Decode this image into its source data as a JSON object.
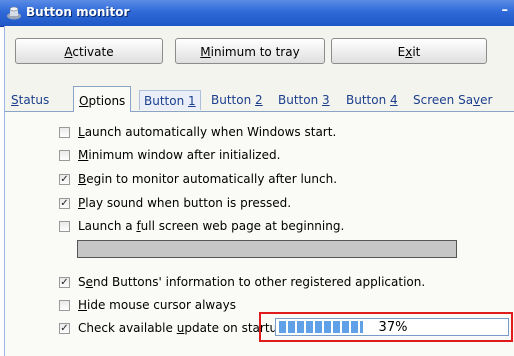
{
  "window": {
    "title": "Button monitor"
  },
  "toolbar": {
    "activate": {
      "pre": "",
      "key": "A",
      "post": "ctivate"
    },
    "minimum_to_tray": {
      "pre": "",
      "key": "M",
      "post": "inimum to tray"
    },
    "exit": {
      "pre": "E",
      "key": "x",
      "post": "it"
    }
  },
  "tabs": [
    {
      "pre": "",
      "key": "S",
      "post": "tatus"
    },
    {
      "pre": "",
      "key": "O",
      "post": "ptions"
    },
    {
      "pre": "Button ",
      "key": "1",
      "post": ""
    },
    {
      "pre": "Button ",
      "key": "2",
      "post": ""
    },
    {
      "pre": "Button ",
      "key": "3",
      "post": ""
    },
    {
      "pre": "Button ",
      "key": "4",
      "post": ""
    },
    {
      "pre": "Screen Sa",
      "key": "v",
      "post": "er"
    }
  ],
  "active_tab": "Options",
  "options": [
    {
      "pre": "",
      "key": "L",
      "post": "aunch automatically when Windows start.",
      "checked": false
    },
    {
      "pre": "",
      "key": "M",
      "post": "inimum window after initialized.",
      "checked": false
    },
    {
      "pre": "",
      "key": "B",
      "post": "egin to monitor automatically after lunch.",
      "checked": true
    },
    {
      "pre": "",
      "key": "P",
      "post": "lay sound when button is pressed.",
      "checked": true
    },
    {
      "pre": "Launch a ",
      "key": "f",
      "post": "ull screen web page at beginning.",
      "checked": false
    },
    {
      "pre": "S",
      "key": "e",
      "post": "nd Buttons' information to other registered application.",
      "checked": true
    },
    {
      "pre": "",
      "key": "H",
      "post": "ide mouse cursor always",
      "checked": false
    },
    {
      "pre": "Check available ",
      "key": "u",
      "post": "pdate on startup",
      "checked": true
    }
  ],
  "web_page_url": {
    "value": ""
  },
  "update_progress": {
    "percent": 37,
    "label": "37%"
  },
  "colors": {
    "titlebar": "#2f6ad8",
    "highlight": "#e11b1b",
    "progress": "#5fa0e6"
  }
}
